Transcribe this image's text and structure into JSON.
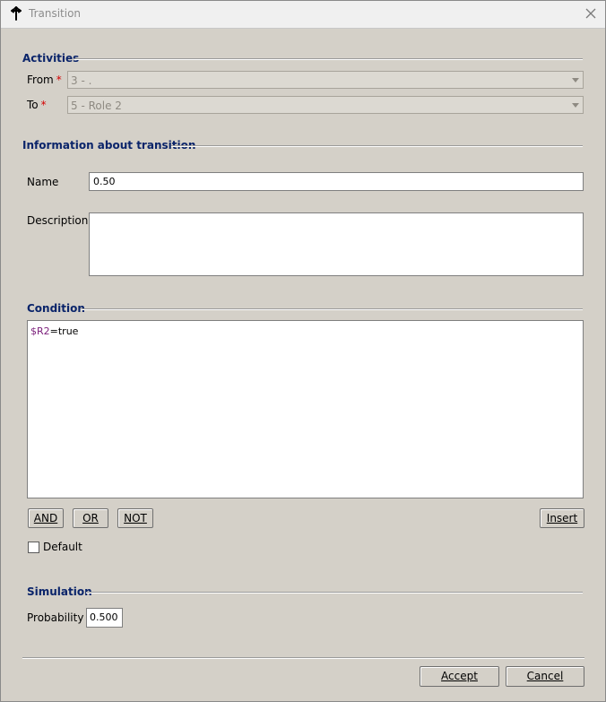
{
  "window": {
    "title": "Transition"
  },
  "activities": {
    "section_title": "Activities",
    "from_label": "From",
    "from_value": "3 - .",
    "to_label": "To",
    "to_value": "5 - Role 2",
    "required_mark": "*"
  },
  "info": {
    "section_title": "Information about transition",
    "name_label": "Name",
    "name_value": "0.50",
    "description_label": "Description",
    "description_value": ""
  },
  "condition": {
    "section_title": "Condition",
    "text_var": "$R2",
    "text_rest": "=true",
    "and_label": "AND",
    "or_label": "OR",
    "not_label": "NOT",
    "insert_label": "Insert",
    "default_label": "Default",
    "default_checked": false
  },
  "simulation": {
    "section_title": "Simulation",
    "probability_label": "Probability",
    "probability_value": "0.500"
  },
  "footer": {
    "accept_label": "Accept",
    "cancel_label": "Cancel"
  }
}
